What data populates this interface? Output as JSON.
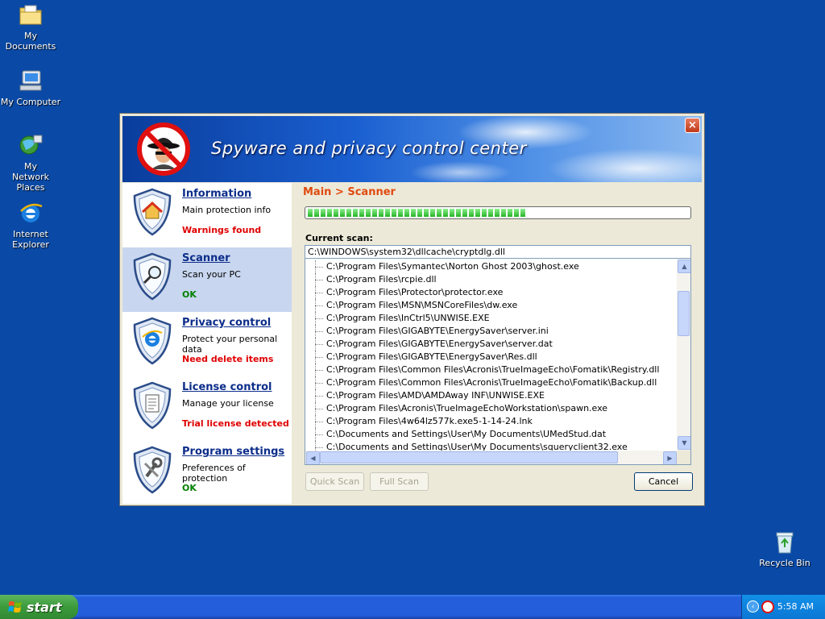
{
  "desktop": {
    "icons": [
      {
        "label": "My Documents",
        "icon": "my-documents-icon"
      },
      {
        "label": "My Computer",
        "icon": "my-computer-icon"
      },
      {
        "label": "My Network Places",
        "icon": "network-places-icon"
      },
      {
        "label": "Internet Explorer",
        "icon": "internet-explorer-icon"
      },
      {
        "label": "Recycle Bin",
        "icon": "recycle-bin-icon"
      }
    ]
  },
  "window": {
    "title": "Spyware and privacy control center",
    "close_label": "×"
  },
  "sidebar": {
    "items": [
      {
        "title": "Information",
        "desc": "Main protection info",
        "status": "Warnings found",
        "status_color": "#e00000",
        "icon": "home-shield-icon"
      },
      {
        "title": "Scanner",
        "desc": "Scan your PC",
        "status": "OK",
        "status_color": "#008000",
        "icon": "magnifier-shield-icon"
      },
      {
        "title": "Privacy control",
        "desc": "Protect your personal data",
        "status": "Need delete items",
        "status_color": "#e00000",
        "icon": "ie-shield-icon"
      },
      {
        "title": "License control",
        "desc": "Manage your license",
        "status": "Trial license detected",
        "status_color": "#e00000",
        "icon": "document-shield-icon"
      },
      {
        "title": "Program settings",
        "desc": "Preferences of protection",
        "status": "OK",
        "status_color": "#008000",
        "icon": "wrench-shield-icon"
      }
    ]
  },
  "main": {
    "breadcrumb": "Main > Scanner",
    "progress": 0.58,
    "current_scan_label": "Current scan:",
    "current_scan_path": "C:\\WINDOWS\\system32\\dllcache\\cryptdlg.dll",
    "files": [
      "C:\\Program Files\\Symantec\\Norton Ghost 2003\\ghost.exe",
      "C:\\Program Files\\rcpie.dll",
      "C:\\Program Files\\Protector\\protector.exe",
      "C:\\Program Files\\MSN\\MSNCoreFiles\\dw.exe",
      "C:\\Program Files\\InCtrl5\\UNWISE.EXE",
      "C:\\Program Files\\GIGABYTE\\EnergySaver\\server.ini",
      "C:\\Program Files\\GIGABYTE\\EnergySaver\\server.dat",
      "C:\\Program Files\\GIGABYTE\\EnergySaver\\Res.dll",
      "C:\\Program Files\\Common Files\\Acronis\\TrueImageEcho\\Fomatik\\Registry.dll",
      "C:\\Program Files\\Common Files\\Acronis\\TrueImageEcho\\Fomatik\\Backup.dll",
      "C:\\Program Files\\AMD\\AMDAway INF\\UNWISE.EXE",
      "C:\\Program Files\\Acronis\\TrueImageEchoWorkstation\\spawn.exe",
      "C:\\Program Files\\4w64lz577k.exe5-1-14-24.lnk",
      "C:\\Documents and Settings\\User\\My Documents\\UMedStud.dat",
      "C:\\Documents and Settings\\User\\My Documents\\squeryclient32.exe"
    ],
    "quick_scan_label": "Quick Scan",
    "full_scan_label": "Full Scan",
    "cancel_label": "Cancel"
  },
  "taskbar": {
    "start_label": "start",
    "clock": "5:58 AM"
  },
  "colors": {
    "desktop": "#0a4aa6",
    "accent_orange": "#e04a10",
    "progress_green": "#24b324",
    "link_blue": "#0c2d8a"
  }
}
